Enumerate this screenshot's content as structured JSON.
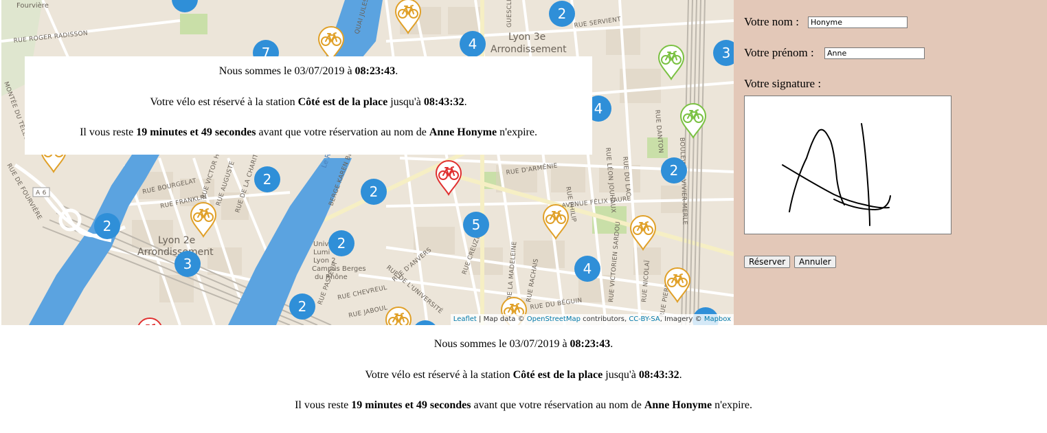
{
  "map": {
    "area_labels": [
      "Lyon 3e",
      "Arrondissement",
      "Lyon 2e",
      "Arrondissement"
    ],
    "place_labels": [
      "Fourvière",
      "Université Lumière Lyon 2 - Campus Berges du Rhône"
    ],
    "place_labels_short": [
      "Univ",
      "Lumi",
      "Lyon 2",
      "Campus Berges",
      "du Rhône"
    ],
    "road_labels": [
      "RUE ROGER RADISSON",
      "RUE SERVIENT",
      "GUESCLIN",
      "QUAI JULES C",
      "RUE D'ARMÉNIE",
      "RUE DANTON",
      "RUE LÉON JOUHAUX",
      "RUE DU LAC",
      "BOULEVARD VIVIER-MERLE",
      "AVENUE FÉLIX FAURE",
      "RUE BOURGELAT",
      "RUE FRANKLIN",
      "RUE VICTOR H",
      "RUE AUGUSTE",
      "RUE DE LA CHARITÉ",
      "BERGE KAREN BLIXEN",
      "RUE D'ANVERS",
      "RUE DE L'UNIVERSITÉ",
      "RUE CREUZET",
      "RUE PASTEUR",
      "RUE CHEVREUL",
      "RUE JABOUL",
      "RUE DE LA MADELEINE",
      "RUE RACHAIS",
      "RUE DU BÉGUIN",
      "RUE VICTORIEN SARDOU",
      "RUE NICOLAÏ",
      "RUE PIERRE",
      "RUE PHILIP",
      "A 6",
      "RUE DE FOURVIÈRE",
      "MONTÉE DU TÉLÉG",
      "Le Rhône"
    ],
    "clusters": [
      "2",
      "4",
      "7",
      "3",
      "4",
      "2",
      "2",
      "2",
      "2",
      "5",
      "2",
      "3",
      "2",
      "4"
    ],
    "pins": [
      {
        "color": "#e0a028",
        "status": "available-partial"
      },
      {
        "color": "#e0a028",
        "status": "available-partial"
      },
      {
        "color": "#7ac142",
        "status": "available"
      },
      {
        "color": "#7ac142",
        "status": "available"
      },
      {
        "color": "#e03030",
        "status": "empty"
      },
      {
        "color": "#e0a028",
        "status": "available-partial"
      },
      {
        "color": "#e0a028",
        "status": "available-partial"
      },
      {
        "color": "#e0a028",
        "status": "available-partial"
      },
      {
        "color": "#e0a028",
        "status": "available-partial"
      },
      {
        "color": "#e0a028",
        "status": "available-partial"
      },
      {
        "color": "#e0a028",
        "status": "available-partial"
      }
    ],
    "attribution": {
      "leaflet": "Leaflet",
      "sep1": " | Map data © ",
      "osm": "OpenStreetMap",
      "contributors": " contributors, ",
      "license": "CC-BY-SA",
      "imagery": ", Imagery © ",
      "mapbox": "Mapbox"
    }
  },
  "reservation": {
    "line1_prefix": "Nous sommes le 03/07/2019 à ",
    "current_time": "08:23:43",
    "line1_suffix": ".",
    "line2_prefix": "Votre vélo est réservé à la station ",
    "station_name": "Côté est de la place",
    "line2_mid": " jusqu'à ",
    "expiry_time": "08:43:32",
    "line2_suffix": ".",
    "line3_prefix": "Il vous reste ",
    "remaining": "19 minutes et 49 secondes",
    "line3_mid": " avant que votre réservation au nom de ",
    "user_fullname": "Anne Honyme",
    "line3_suffix": " n'expire."
  },
  "form": {
    "lastname_label": "Votre nom :",
    "lastname_value": "Honyme",
    "firstname_label": "Votre prénom :",
    "firstname_value": "Anne",
    "signature_label": "Votre signature :",
    "reserve_button": "Réserver",
    "cancel_button": "Annuler"
  },
  "colors": {
    "cluster": "#2f8fd8",
    "form_background": "#e3c8b8",
    "river": "#5ba3e0",
    "pin_orange": "#e0a028",
    "pin_green": "#7ac142",
    "pin_red": "#e03030"
  }
}
